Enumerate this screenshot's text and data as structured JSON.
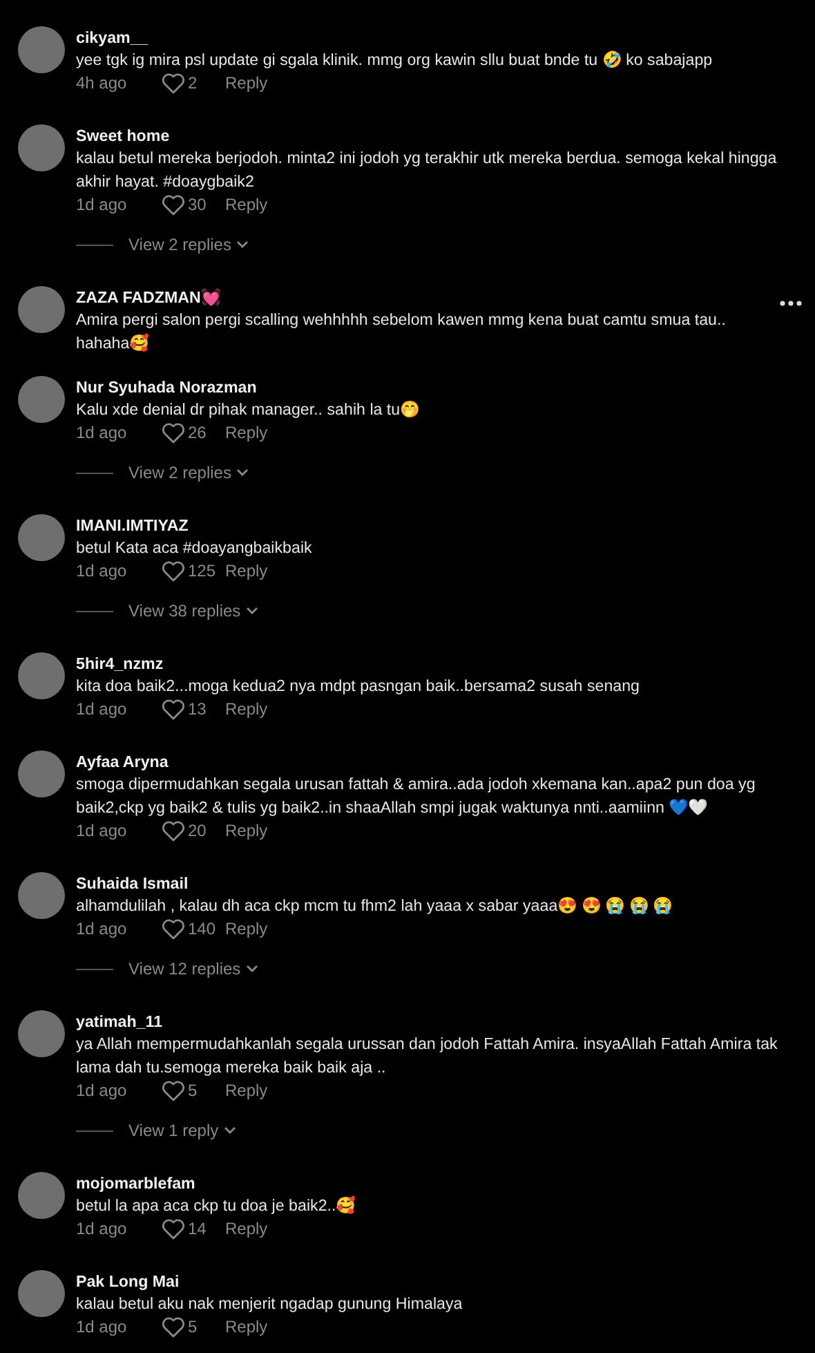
{
  "comments": [
    {
      "user": "cikyam__",
      "text": "yee tgk ig mira psl update gi sgala klinik. mmg org kawin sllu buat bnde tu 🤣 ko sabajapp",
      "time": "4h ago",
      "likes": "2",
      "reply": "Reply"
    },
    {
      "user": "Sweet home",
      "text": "kalau betul mereka berjodoh. minta2 ini jodoh yg terakhir utk mereka berdua. semoga kekal hingga akhir hayat. #doaygbaik2",
      "time": "1d ago",
      "likes": "30",
      "reply": "Reply",
      "view_replies": "View 2 replies"
    },
    {
      "user": "ZAZA FADZMAN💓",
      "text": "Amira pergi salon pergi scalling wehhhhh sebelom kawen mmg kena buat camtu smua tau.. hahaha🥰",
      "more": true
    },
    {
      "user": "Nur Syuhada Norazman",
      "text": "Kalu xde denial dr pihak manager.. sahih la tu🤭",
      "time": "1d ago",
      "likes": "26",
      "reply": "Reply",
      "view_replies": "View 2 replies"
    },
    {
      "user": "IMANI.IMTIYAZ",
      "text": "betul Kata aca #doayangbaikbaik",
      "time": "1d ago",
      "likes": "125",
      "reply": "Reply",
      "view_replies": "View 38 replies"
    },
    {
      "user": "5hir4_nzmz",
      "text": "kita doa baik2...moga kedua2 nya mdpt pasngan baik..bersama2 susah senang",
      "time": "1d ago",
      "likes": "13",
      "reply": "Reply"
    },
    {
      "user": "Ayfaa Aryna",
      "text": "smoga dipermudahkan segala urusan fattah & amira..ada jodoh xkemana kan..apa2 pun doa yg baik2,ckp yg baik2 & tulis yg baik2..in shaaAllah smpi jugak waktunya nnti..aamiinn 💙🤍",
      "time": "1d ago",
      "likes": "20",
      "reply": "Reply"
    },
    {
      "user": "Suhaida Ismail",
      "text": "alhamdulilah , kalau dh aca ckp mcm tu fhm2 lah yaaa x sabar yaaa😍 😍 😭 😭 😭",
      "time": "1d ago",
      "likes": "140",
      "reply": "Reply",
      "view_replies": "View 12 replies"
    },
    {
      "user": "yatimah_11",
      "text": "ya Allah mempermudahkanlah segala urussan dan jodoh Fattah Amira. insyaAllah Fattah Amira tak lama dah tu.semoga mereka baik baik aja ..",
      "time": "1d ago",
      "likes": "5",
      "reply": "Reply",
      "view_replies": "View 1 reply"
    },
    {
      "user": "mojomarblefam",
      "text": "betul la apa aca ckp tu doa je baik2..🥰",
      "time": "1d ago",
      "likes": "14",
      "reply": "Reply"
    },
    {
      "user": "Pak Long Mai",
      "text": "kalau betul aku nak menjerit ngadap gunung Himalaya",
      "time": "1d ago",
      "likes": "5",
      "reply": "Reply"
    }
  ]
}
